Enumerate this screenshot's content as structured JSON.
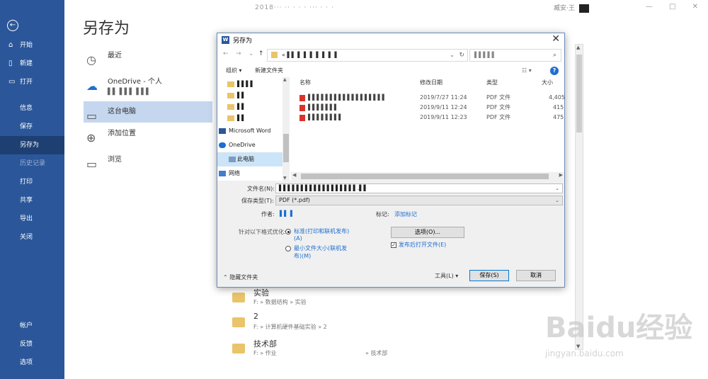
{
  "titlebar": {
    "doc_title": "2018··· ·· · · · ··· · · ·",
    "user_name": "臧安·王",
    "controls": [
      "—",
      "□",
      "✕"
    ]
  },
  "nav": {
    "back_icon": "back-arrow-icon",
    "items": [
      {
        "label": "开始",
        "icon": "home-icon"
      },
      {
        "label": "新建",
        "icon": "new-doc-icon"
      },
      {
        "label": "打开",
        "icon": "open-folder-icon"
      },
      {
        "label": "信息"
      },
      {
        "label": "保存"
      },
      {
        "label": "另存为"
      },
      {
        "label": "历史记录"
      },
      {
        "label": "打印"
      },
      {
        "label": "共享"
      },
      {
        "label": "导出"
      },
      {
        "label": "关闭"
      }
    ],
    "bottom_items": [
      {
        "label": "帐户"
      },
      {
        "label": "反馈"
      },
      {
        "label": "选项"
      }
    ]
  },
  "backstage": {
    "title": "另存为",
    "locations": [
      {
        "label": "最近"
      },
      {
        "label": "OneDrive - 个人",
        "sub": "▌▌ ▌▌▌ ▌▌▌"
      },
      {
        "label": "这台电脑"
      },
      {
        "label": "添加位置"
      },
      {
        "label": "浏览"
      }
    ],
    "folders": [
      {
        "name": "实验",
        "path": "F: » 数据结构 » 实验"
      },
      {
        "name": "2",
        "path": "F: » 计算机硬件基础实验 » 2"
      },
      {
        "name": "技术部",
        "path": "F: » 作业",
        "path2": "» 技术部"
      }
    ]
  },
  "dialog": {
    "title": "另存为",
    "address": "« ▌▌ ▌ ▌ ▌ ▌ ▌ ▌ ▌",
    "search_placeholder": "▌▌▌▌▌",
    "toolbar": {
      "organize": "组织 ▾",
      "new_folder": "新建文件夹"
    },
    "tree": [
      {
        "label": "▌▌▌▌",
        "icon": "folder"
      },
      {
        "label": "▌▌",
        "icon": "folder"
      },
      {
        "label": "▌▌",
        "icon": "folder"
      },
      {
        "label": "▌▌",
        "icon": "folder"
      },
      {
        "label": "Microsoft Word",
        "icon": "word"
      },
      {
        "label": "OneDrive",
        "icon": "cloud"
      },
      {
        "label": "此电脑",
        "icon": "pc"
      },
      {
        "label": "网络",
        "icon": "network"
      }
    ],
    "columns": [
      "名称",
      "修改日期",
      "类型",
      "大小"
    ],
    "files": [
      {
        "name": "▌▌▌▌▌▌▌▌▌▌▌▌▌▌▌▌▌▌",
        "date": "2019/7/27 11:24",
        "type": "PDF 文件",
        "size": "4,405"
      },
      {
        "name": "▌▌▌▌▌▌▌",
        "date": "2019/9/11 12:24",
        "type": "PDF 文件",
        "size": "415"
      },
      {
        "name": "▌▌▌▌▌▌▌▌",
        "date": "2019/9/11 12:23",
        "type": "PDF 文件",
        "size": "475"
      }
    ],
    "filename_label": "文件名(N):",
    "filename_value": "▌▌▌▌▌▌▌▌▌▌▌▌▌▌▌▌▌▌.▌▌",
    "filetype_label": "保存类型(T):",
    "filetype_value": "PDF (*.pdf)",
    "author_label": "作者:",
    "author_value": "▌▌ ▌",
    "tags_label": "标记:",
    "tags_value": "添加标记",
    "optimize_label": "针对以下格式优化:",
    "radio_standard": "标准(打印和联机发布)",
    "radio_standard_key": "(A)",
    "radio_min": "最小文件大小(联机发",
    "radio_min_2": "布)(M)",
    "options_button": "选项(O)...",
    "open_after_label": "发布后打开文件(E)",
    "hide_folders": "隐藏文件夹",
    "tools": "工具(L)",
    "save": "保存(S)",
    "cancel": "取消"
  },
  "watermark": {
    "text": "Baidu经验",
    "url": "jingyan.baidu.com"
  }
}
